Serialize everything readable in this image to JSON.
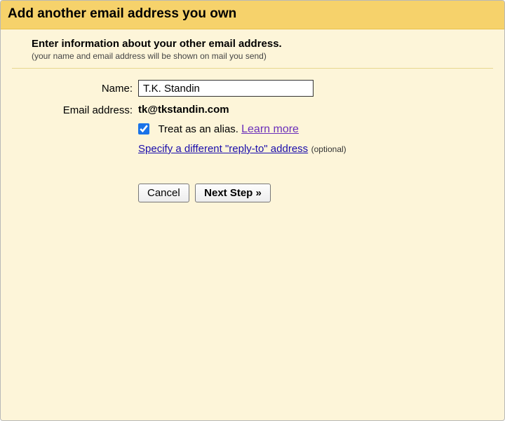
{
  "header": {
    "title": "Add another email address you own"
  },
  "intro": {
    "subtitle": "Enter information about your other email address.",
    "note": "(your name and email address will be shown on mail you send)"
  },
  "form": {
    "name_label": "Name:",
    "name_value": "T.K. Standin",
    "email_label": "Email address:",
    "email_value": "tk@tkstandin.com",
    "alias_text": "Treat as an alias. ",
    "learn_more": "Learn more",
    "replyto_link": "Specify a different \"reply-to\" address",
    "replyto_optional": "(optional)"
  },
  "buttons": {
    "cancel": "Cancel",
    "next": "Next Step »"
  }
}
